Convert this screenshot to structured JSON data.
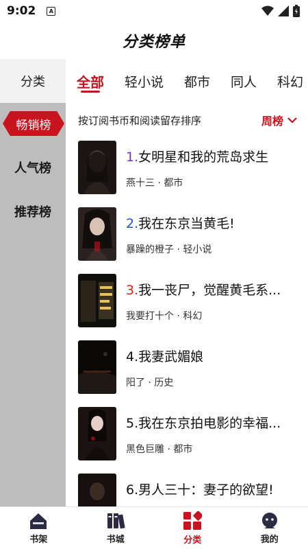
{
  "status_bar": {
    "time": "9:02",
    "indicator": "A"
  },
  "header": {
    "title": "分类榜单"
  },
  "sidebar": {
    "header": "分类",
    "items": [
      {
        "label": "畅销榜",
        "active": true
      },
      {
        "label": "人气榜",
        "active": false
      },
      {
        "label": "推荐榜",
        "active": false
      }
    ]
  },
  "tabs": [
    {
      "label": "全部",
      "active": true
    },
    {
      "label": "轻小说",
      "active": false
    },
    {
      "label": "都市",
      "active": false
    },
    {
      "label": "同人",
      "active": false
    },
    {
      "label": "科幻",
      "active": false
    }
  ],
  "sort": {
    "description": "按订阅书币和阅读留存排序",
    "selected": "周榜",
    "icon": "chevron-down-icon"
  },
  "books": [
    {
      "rank": "1.",
      "title": "女明星和我的荒岛求生",
      "meta": "燕十三 · 都市",
      "rank_color": "#7b2fc9"
    },
    {
      "rank": "2.",
      "title": "我在东京当黄毛!",
      "meta": "暴躁的橙子 · 轻小说",
      "rank_color": "#1f4fe0"
    },
    {
      "rank": "3.",
      "title": "我一丧尸，觉醒黄毛系...",
      "meta": "我要打十个 · 科幻",
      "rank_color": "#d8231c"
    },
    {
      "rank": "4.",
      "title": "我妻武媚娘",
      "meta": "阳了 · 历史",
      "rank_color": "#111111"
    },
    {
      "rank": "5.",
      "title": "我在东京拍电影的幸福...",
      "meta": "黑色巨雕 · 都市",
      "rank_color": "#111111"
    },
    {
      "rank": "6.",
      "title": "男人三十：妻子的欲望!",
      "meta": "",
      "rank_color": "#111111"
    }
  ],
  "bottom_nav": [
    {
      "label": "书架",
      "icon": "bookshelf-icon",
      "active": false
    },
    {
      "label": "书城",
      "icon": "bookstore-icon",
      "active": false
    },
    {
      "label": "分类",
      "icon": "category-icon",
      "active": true
    },
    {
      "label": "我的",
      "icon": "profile-icon",
      "active": false
    }
  ],
  "colors": {
    "accent": "#c8141e",
    "sidebar_bg": "#bdbdbd"
  }
}
